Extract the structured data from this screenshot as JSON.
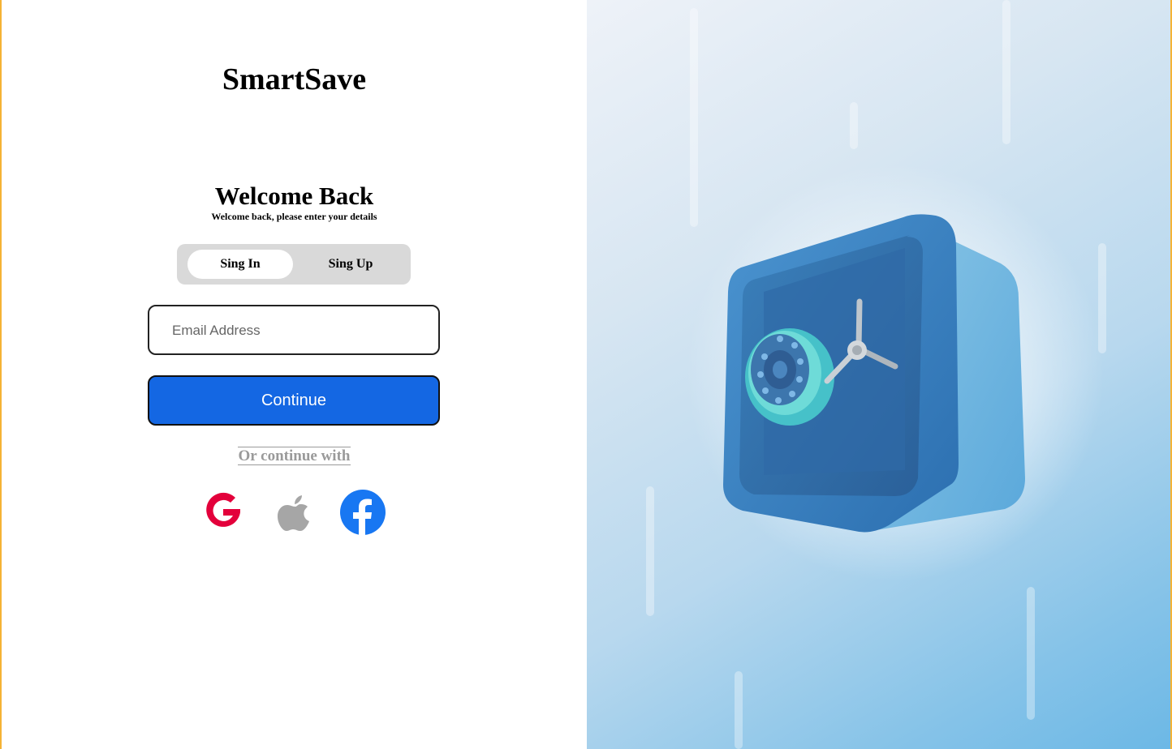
{
  "brand": "SmartSave",
  "heading": "Welcome Back",
  "subheading": "Welcome back, please enter your details",
  "auth_toggle": {
    "sign_in_label": "Sing In",
    "sign_up_label": "Sing Up",
    "selected": "Sing In"
  },
  "email": {
    "placeholder": "Email Address",
    "value": ""
  },
  "continue_label": "Continue",
  "divider_text": "Or continue with",
  "social_icons": [
    "google-icon",
    "apple-icon",
    "facebook-icon"
  ],
  "colors": {
    "primary": "#1467e3",
    "google": "#e3003b",
    "apple": "#a6a6a6",
    "facebook": "#1877f2",
    "safe_blue": "#3a88c9",
    "safe_dial": "#5ecfd0",
    "frame_accent": "#f5b335"
  }
}
